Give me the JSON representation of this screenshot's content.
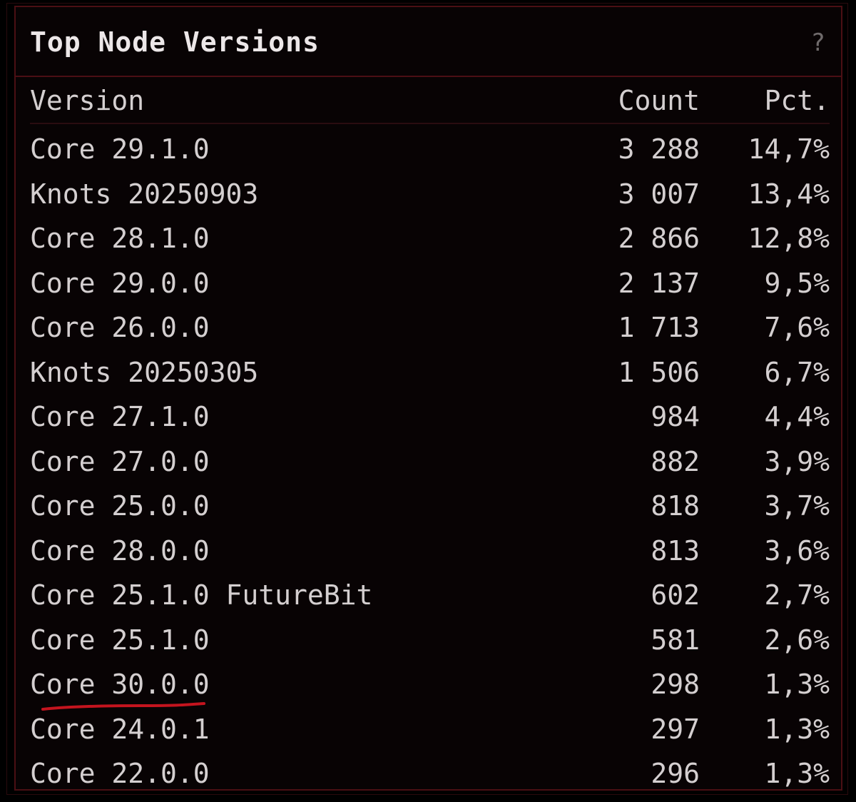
{
  "panel": {
    "title": "Top Node Versions",
    "help_label": "?"
  },
  "table": {
    "columns": [
      "Version",
      "Count",
      "Pct."
    ],
    "rows": [
      {
        "version": "Core 29.1.0",
        "count": "3 288",
        "pct": "14,7%"
      },
      {
        "version": "Knots 20250903",
        "count": "3 007",
        "pct": "13,4%"
      },
      {
        "version": "Core 28.1.0",
        "count": "2 866",
        "pct": "12,8%"
      },
      {
        "version": "Core 29.0.0",
        "count": "2 137",
        "pct": "9,5%"
      },
      {
        "version": "Core 26.0.0",
        "count": "1 713",
        "pct": "7,6%"
      },
      {
        "version": "Knots 20250305",
        "count": "1 506",
        "pct": "6,7%"
      },
      {
        "version": "Core 27.1.0",
        "count": "984",
        "pct": "4,4%"
      },
      {
        "version": "Core 27.0.0",
        "count": "882",
        "pct": "3,9%"
      },
      {
        "version": "Core 25.0.0",
        "count": "818",
        "pct": "3,7%"
      },
      {
        "version": "Core 28.0.0",
        "count": "813",
        "pct": "3,6%"
      },
      {
        "version": "Core 25.1.0 FutureBit",
        "count": "602",
        "pct": "2,7%"
      },
      {
        "version": "Core 25.1.0",
        "count": "581",
        "pct": "2,6%"
      },
      {
        "version": "Core 30.0.0",
        "count": "298",
        "pct": "1,3%"
      },
      {
        "version": "Core 24.0.1",
        "count": "297",
        "pct": "1,3%"
      },
      {
        "version": "Core 22.0.0",
        "count": "296",
        "pct": "1,3%"
      }
    ]
  },
  "annotation": {
    "underlined_row_index": 12,
    "color": "#c4141e"
  },
  "colors": {
    "background": "#000000",
    "panel_border": "#4b0f14",
    "text": "#d4cfd0",
    "title": "#ece7e8"
  }
}
